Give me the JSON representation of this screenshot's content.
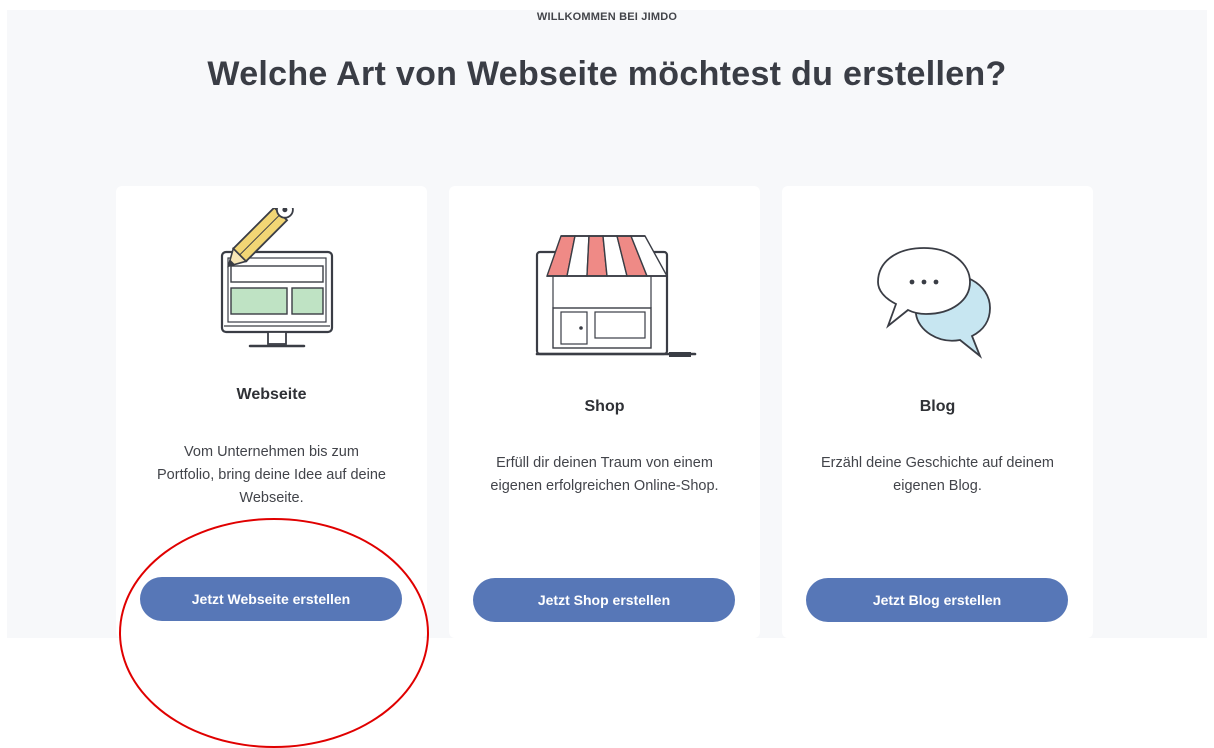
{
  "header": {
    "kicker": "WILLKOMMEN BEI JIMDO",
    "title": "Welche Art von Webseite möchtest du erstellen?"
  },
  "cards": [
    {
      "icon": "monitor-pencil-icon",
      "title": "Webseite",
      "desc_lines": [
        "Vom Unternehmen bis zum",
        "Portfolio, bring deine Idee auf deine",
        "Webseite."
      ],
      "button": "Jetzt Webseite erstellen"
    },
    {
      "icon": "storefront-laptop-icon",
      "title": "Shop",
      "desc_lines": [
        "Erfüll dir deinen Traum von einem",
        "eigenen erfolgreichen Online-Shop."
      ],
      "button": "Jetzt Shop erstellen"
    },
    {
      "icon": "chat-bubbles-icon",
      "title": "Blog",
      "desc_lines": [
        "Erzähl deine Geschichte auf deinem",
        "eigenen Blog."
      ],
      "button": "Jetzt Blog erstellen"
    }
  ],
  "colors": {
    "background": "#f7f8fa",
    "card": "#ffffff",
    "button": "#5777b7",
    "annotation": "#e00000"
  }
}
